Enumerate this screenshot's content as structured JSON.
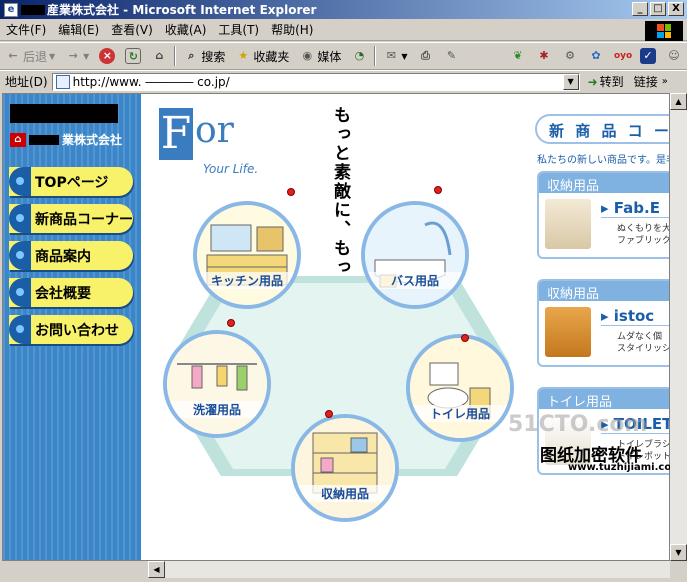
{
  "window": {
    "title_suffix": "産業株式会社 - Microsoft Internet Explorer",
    "buttons": [
      "_",
      "□",
      "X"
    ]
  },
  "menu": [
    "文件(F)",
    "编辑(E)",
    "查看(V)",
    "收藏(A)",
    "工具(T)",
    "帮助(H)"
  ],
  "toolbar": {
    "back": "后退",
    "search": "搜索",
    "favorites": "收藏夹",
    "media": "媒体"
  },
  "address": {
    "label": "地址(D)",
    "url": "http://www.  ――――  co.jp/",
    "go": "转到",
    "links": "链接"
  },
  "sidebar": {
    "company": "業株式会社",
    "nav": [
      "TOPページ",
      "新商品コーナー",
      "商品案内",
      "会社概要",
      "お問い合わせ"
    ]
  },
  "hero": {
    "logo_letter": "F",
    "logo_rest": "or",
    "logo_sub": "Your Life.",
    "tagline": "もっと素敵に、もっと便利に安全に…。",
    "rooms": [
      "キッチン用品",
      "バス用品",
      "洗濯用品",
      "トイレ用品",
      "収納用品"
    ]
  },
  "right": {
    "new_title": "新 商 品 コ ー",
    "new_sub": "私たちの新しい商品です。是非",
    "categories": [
      {
        "head": "収納用品",
        "name": "Fab.E",
        "desc1": "ぬくもりを大",
        "desc2": "ファブリック"
      },
      {
        "head": "収納用品",
        "name": "istoc",
        "desc1": "ムダなく個",
        "desc2": "スタイリッシ"
      },
      {
        "head": "トイレ用品",
        "name": "TOILET",
        "desc1": "トイレブラシ",
        "desc2": "トイレポット"
      }
    ]
  },
  "watermark": {
    "site": "51CTO.com",
    "text": "图纸加密软件",
    "url": "www.tuzhijiami.com"
  },
  "colors": {
    "sidebar": "#3b86c8",
    "nav_button": "#f7f26a",
    "accent": "#1a5ea8",
    "titlebar": "#0a246a"
  }
}
